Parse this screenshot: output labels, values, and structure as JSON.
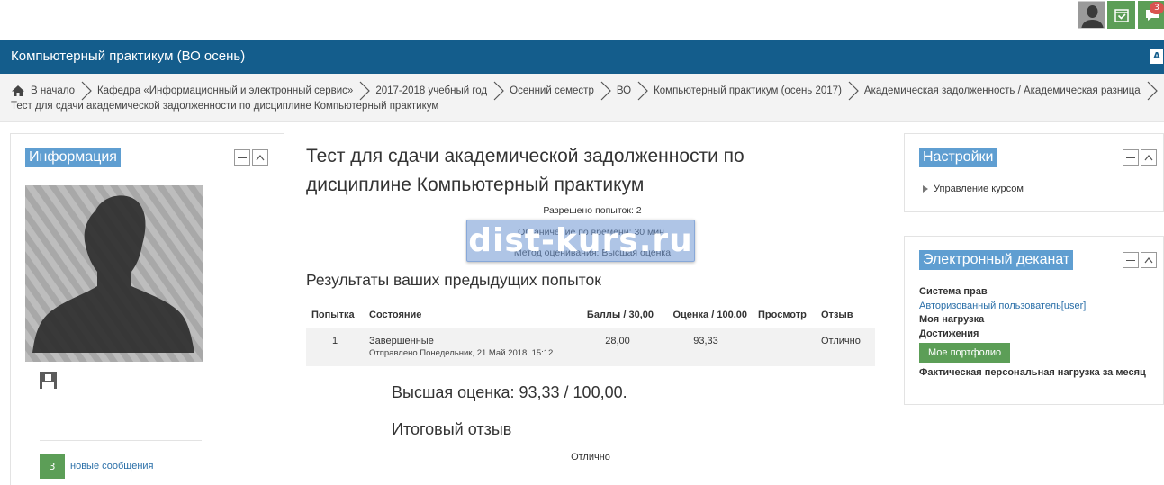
{
  "topbar": {
    "avatar_icon": "user-avatar-icon",
    "calendar_icon": "calendar-check-icon",
    "messages_icon": "message-bubble-icon",
    "messages_badge": "3",
    "accent_color": "#5c9e57"
  },
  "navbar": {
    "site_title": "Компьютерный практикум (ВО осень)",
    "language_icon": "translate-icon",
    "color": "#145d8c"
  },
  "breadcrumb": {
    "items": [
      "В начало",
      "Кафедра «Информационный и электронный сервис»",
      "2017-2018 учебный год",
      "Осенний семестр",
      "ВО",
      "Компьютерный практикум (осень 2017)",
      "Академическая задолженность / Академическая разница"
    ],
    "current": "Тест для сдачи академической задолженности по дисциплине Компьютерный практикум"
  },
  "info_block": {
    "title": "Информация",
    "new_messages_count": "3",
    "new_messages_label": "новые сообщения"
  },
  "main": {
    "quiz_title": "Тест для сдачи академической задолженности по дисциплине Компьютерный практикум",
    "attempts_allowed": "Разрешено попыток: 2",
    "time_limit": "Ограничение по времени: 30 мин.",
    "grading_method": "Метод оценивания: Высшая оценка",
    "watermark": "dist-kurs.ru",
    "results_title": "Результаты ваших предыдущих попыток",
    "table": {
      "headers": [
        "Попытка",
        "Состояние",
        "Баллы / 30,00",
        "Оценка / 100,00",
        "Просмотр",
        "Отзыв"
      ],
      "rows": [
        {
          "attempt": "1",
          "state": "Завершенные",
          "submitted": "Отправлено Понедельник, 21 Май 2018, 15:12",
          "score": "28,00",
          "grade": "93,33",
          "review": "",
          "feedback": "Отлично"
        }
      ]
    },
    "best_grade": "Высшая оценка: 93,33 / 100,00.",
    "final_feedback_title": "Итоговый отзыв",
    "final_feedback": "Отлично"
  },
  "settings_block": {
    "title": "Настройки",
    "item": "Управление курсом"
  },
  "dean_block": {
    "title": "Электронный деканат",
    "rights_label": "Система прав",
    "rights_link": "Авторизованный пользователь[user]",
    "workload": "Моя нагрузка",
    "achievements": "Достижения",
    "portfolio_button": "Мое портфолио",
    "actual_workload": "Фактическая персональная нагрузка за месяц"
  },
  "colors": {
    "block_title_bg": "#5f9ed1",
    "link": "#2a6fa8",
    "green": "#5c9e57"
  }
}
